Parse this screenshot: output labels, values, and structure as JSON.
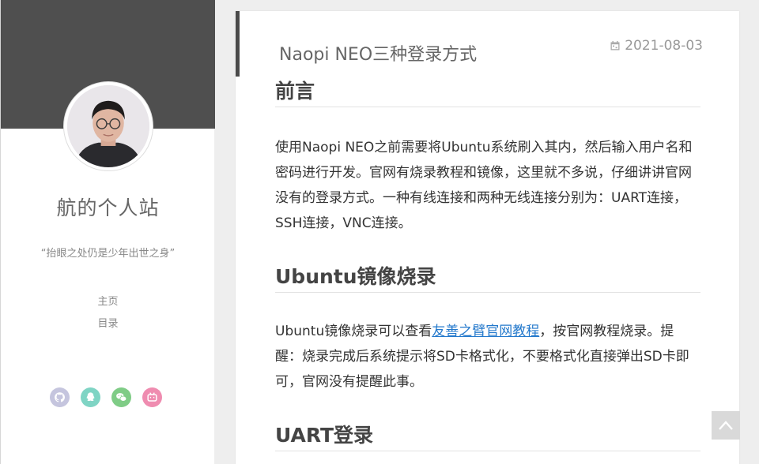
{
  "sidebar": {
    "site_title": "航的个人站",
    "motto": "“抬眼之处仍是少年出世之身”",
    "nav": [
      {
        "label": "主页"
      },
      {
        "label": "目录"
      }
    ],
    "social": [
      {
        "icon": "github-icon",
        "color": "#c5c5de"
      },
      {
        "icon": "qq-icon",
        "color": "#7fd4c4"
      },
      {
        "icon": "wechat-icon",
        "color": "#7fcc86"
      },
      {
        "icon": "bilibili-icon",
        "color": "#ef8cb0"
      }
    ]
  },
  "post": {
    "title": "Naopi NEO三种登录方式",
    "date": "2021-08-03",
    "sections": {
      "intro_heading": "前言",
      "intro_text": "使用Naopi NEO之前需要将Ubuntu系统刷入其内，然后输入用户名和密码进行开发。官网有烧录教程和镜像，这里就不多说，仔细讲讲官网没有的登录方式。一种有线连接和两种无线连接分别为：UART连接，SSH连接，VNC连接。",
      "ubuntu_heading": "Ubuntu镜像烧录",
      "ubuntu_text_before": "Ubuntu镜像烧录可以查看",
      "ubuntu_link": "友善之臂官网教程",
      "ubuntu_text_after": "，按官网教程烧录。提醒：烧录完成后系统提示将SD卡格式化，不要格式化直接弹出SD卡即可，官网没有提醒此事。",
      "uart_heading": "UART登录"
    }
  },
  "colors": {
    "banner": "#4f4f4f",
    "link": "#2479cc",
    "back_to_top": "#d9d9d9"
  }
}
